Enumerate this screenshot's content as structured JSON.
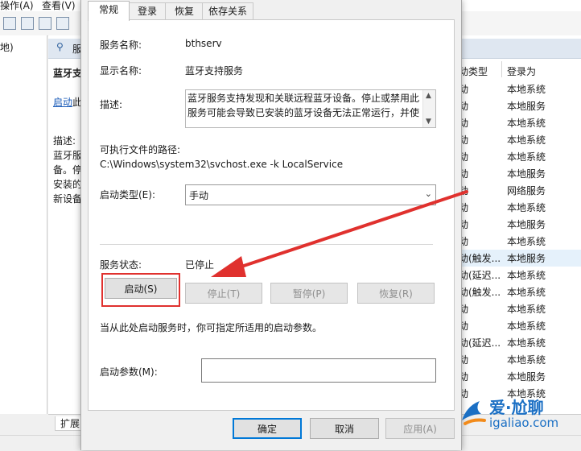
{
  "background": {
    "menu": [
      "操作(A)",
      "查看(V)"
    ],
    "left_pane_text": "地)",
    "pane_header_text": "服",
    "service_title_frag": "蓝牙支",
    "start_link_frag": "启动",
    "start_link_suffix": "此",
    "desc_lines": [
      "描述:",
      "蓝牙服",
      "备。停",
      "安装的",
      "新设备"
    ],
    "col_header_startup": "动类型",
    "col_header_logon": "登录为",
    "rows": [
      {
        "startup": "动",
        "logon": "本地系统"
      },
      {
        "startup": "动",
        "logon": "本地服务"
      },
      {
        "startup": "动",
        "logon": "本地系统"
      },
      {
        "startup": "动",
        "logon": "本地系统"
      },
      {
        "startup": "动",
        "logon": "本地系统"
      },
      {
        "startup": "动",
        "logon": "本地服务"
      },
      {
        "startup": "动",
        "logon": "网络服务"
      },
      {
        "startup": "动",
        "logon": "本地系统"
      },
      {
        "startup": "动",
        "logon": "本地服务"
      },
      {
        "startup": "动",
        "logon": "本地系统"
      },
      {
        "startup": "动(触发...",
        "logon": "本地服务"
      },
      {
        "startup": "动(延迟...",
        "logon": "本地系统"
      },
      {
        "startup": "动(触发...",
        "logon": "本地系统"
      },
      {
        "startup": "动",
        "logon": "本地系统"
      },
      {
        "startup": "动",
        "logon": "本地系统"
      },
      {
        "startup": "动(延迟...",
        "logon": "本地系统"
      },
      {
        "startup": "动",
        "logon": "本地系统"
      },
      {
        "startup": "动",
        "logon": "本地服务"
      },
      {
        "startup": "动",
        "logon": "本地系统"
      }
    ],
    "bottom_tab": "扩展"
  },
  "dialog": {
    "tabs": [
      "常规",
      "登录",
      "恢复",
      "依存关系"
    ],
    "service_name_label": "服务名称:",
    "service_name_value": "bthserv",
    "display_name_label": "显示名称:",
    "display_name_value": "蓝牙支持服务",
    "description_label": "描述:",
    "description_text": "蓝牙服务支持发现和关联远程蓝牙设备。停止或禁用此服务可能会导致已安装的蓝牙设备无法正常运行，并使",
    "path_label": "可执行文件的路径:",
    "path_value": "C:\\Windows\\system32\\svchost.exe -k LocalService",
    "startup_type_label": "启动类型(E):",
    "startup_type_value": "手动",
    "status_label": "服务状态:",
    "status_value": "已停止",
    "btn_start": "启动(S)",
    "btn_stop": "停止(T)",
    "btn_pause": "暂停(P)",
    "btn_resume": "恢复(R)",
    "hint_text": "当从此处启动服务时，你可指定所适用的启动参数。",
    "params_label": "启动参数(M):",
    "params_value": "",
    "btn_ok": "确定",
    "btn_cancel": "取消",
    "btn_apply": "应用(A)"
  },
  "watermark": {
    "title": "爱·尬聊",
    "url": "igaliao.com"
  },
  "colors": {
    "highlight_red": "#e0312e",
    "accent_blue": "#0078d7"
  }
}
